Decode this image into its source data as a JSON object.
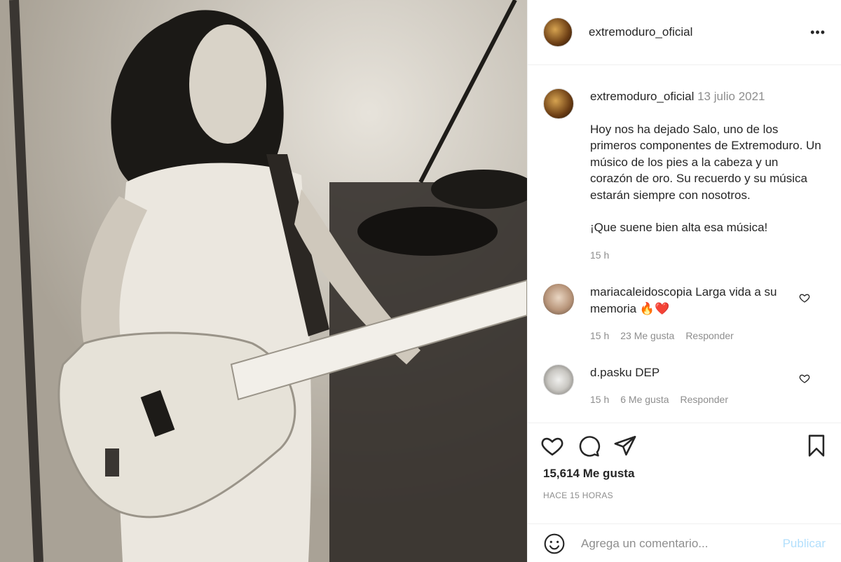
{
  "photo": {
    "alt": "Black and white photo of bassist on stage"
  },
  "header": {
    "username": "extremoduro_oficial",
    "more_icon": "more-horizontal-icon"
  },
  "caption": {
    "username": "extremoduro_oficial",
    "date": "13 julio 2021",
    "line1": "Hoy nos ha dejado Salo, uno de los primeros componentes de Extremoduro. Un músico de los pies a la cabeza y un corazón de oro. Su recuerdo y su música estarán siempre con nosotros.",
    "line2": "¡Que suene bien alta esa música!",
    "time": "15 h"
  },
  "comments": [
    {
      "username": "mariacaleidoscopia",
      "text": "Larga vida a su memoria 🔥❤️",
      "time": "15 h",
      "likes": "23 Me gusta",
      "reply": "Responder"
    },
    {
      "username": "d.pasku",
      "text": "DEP",
      "time": "15 h",
      "likes": "6 Me gusta",
      "reply": "Responder"
    }
  ],
  "actions": {
    "like_icon": "heart-icon",
    "comment_icon": "comment-icon",
    "share_icon": "send-icon",
    "save_icon": "bookmark-icon"
  },
  "likes": "15,614 Me gusta",
  "posted": "HACE 15 HORAS",
  "add_comment": {
    "placeholder": "Agrega un comentario...",
    "publish": "Publicar"
  }
}
